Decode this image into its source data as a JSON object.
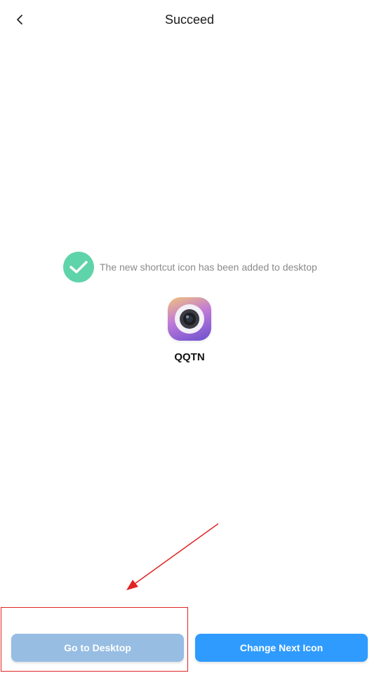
{
  "header": {
    "title": "Succeed",
    "back_icon": "chevron-left-icon"
  },
  "status": {
    "message": "The new shortcut icon has been added to desktop",
    "check_icon": "checkmark-icon",
    "check_color": "#5fd3a9"
  },
  "shortcut": {
    "name": "QQTN",
    "icon": "camera-lens-app-icon"
  },
  "actions": {
    "go_to_desktop_label": "Go to Desktop",
    "change_next_icon_label": "Change Next Icon",
    "go_to_desktop_color": "#97bde3",
    "change_next_icon_color": "#2f9bff"
  },
  "annotation": {
    "color": "#e02424",
    "arrow_icon": "red-arrow-annotation",
    "highlight": "red-highlight-box"
  }
}
